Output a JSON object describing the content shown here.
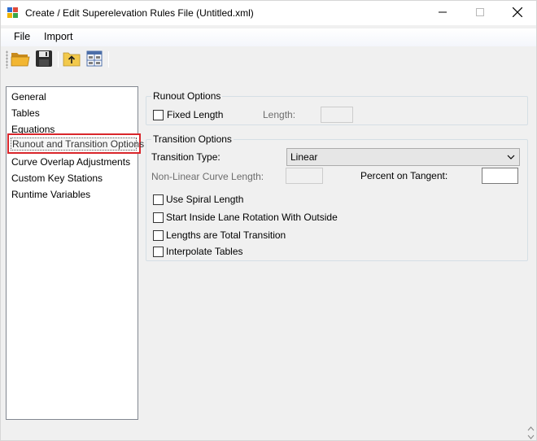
{
  "window": {
    "title": "Create / Edit Superelevation Rules File (Untitled.xml)",
    "icons": {
      "app": "app-icon",
      "minimize": "minimize-icon",
      "maximize": "maximize-icon",
      "close": "close-icon"
    }
  },
  "menubar": {
    "file_label": "File",
    "import_label": "Import"
  },
  "toolbar": {
    "buttons": [
      {
        "icon": "open-folder-icon"
      },
      {
        "icon": "save-icon"
      },
      {
        "icon": "folder-up-icon"
      },
      {
        "icon": "grid-settings-icon"
      }
    ]
  },
  "nav": {
    "items": [
      {
        "label": "General"
      },
      {
        "label": "Tables"
      },
      {
        "label": "Equations"
      },
      {
        "label": "Runout and Transition Options",
        "selected": true
      },
      {
        "label": "Curve Overlap Adjustments"
      },
      {
        "label": "Custom Key Stations"
      },
      {
        "label": "Runtime Variables"
      }
    ]
  },
  "runout": {
    "group_title": "Runout Options",
    "fixed_length_label": "Fixed Length",
    "fixed_length_checked": false,
    "length_label": "Length:",
    "length_value": ""
  },
  "transition": {
    "group_title": "Transition Options",
    "type_label": "Transition Type:",
    "type_value": "Linear",
    "nonlinear_label": "Non-Linear Curve Length:",
    "nonlinear_value": "",
    "percent_label": "Percent on Tangent:",
    "percent_value": "",
    "checkboxes": [
      {
        "label": "Use Spiral Length",
        "checked": false
      },
      {
        "label": "Start Inside Lane Rotation With Outside",
        "checked": false
      },
      {
        "label": "Lengths are Total Transition",
        "checked": false
      },
      {
        "label": "Interpolate Tables",
        "checked": false
      }
    ]
  },
  "colors": {
    "selection_border": "#d9262b",
    "disabled_text": "#6d6d6d"
  }
}
